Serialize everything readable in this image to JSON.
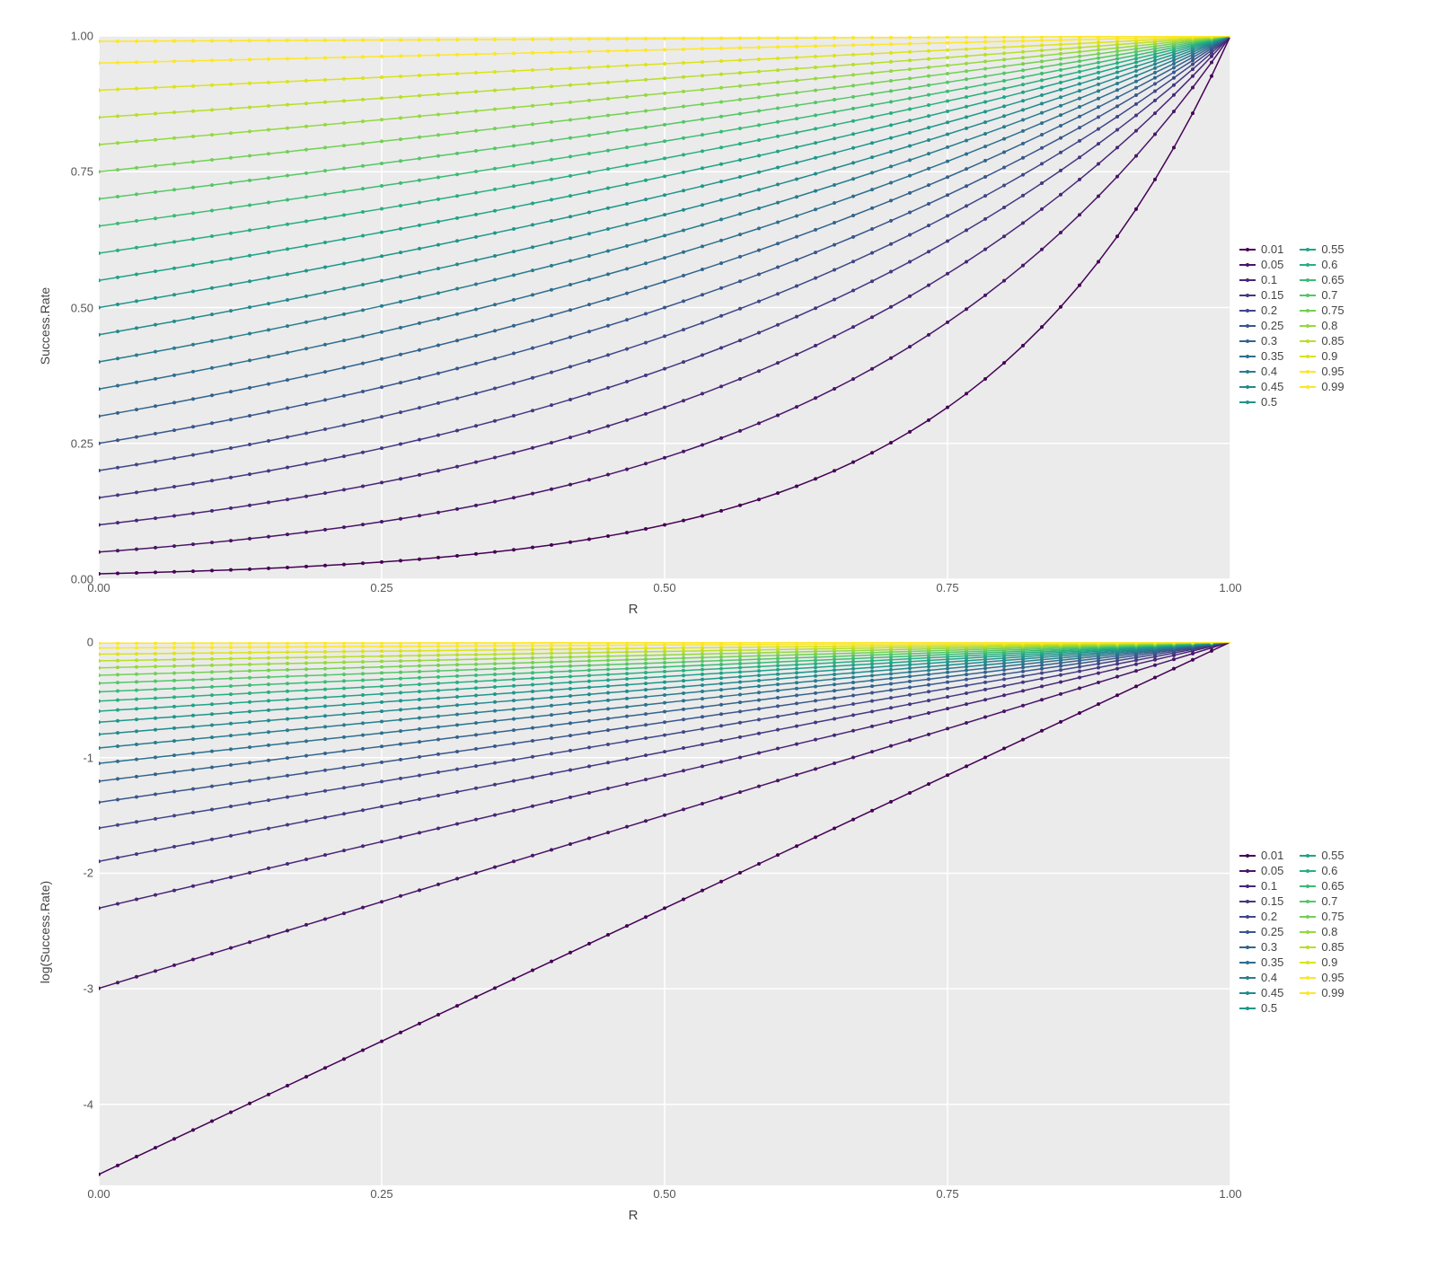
{
  "chart_data": [
    {
      "type": "line",
      "xlabel": "R",
      "ylabel": "Success.Rate",
      "xlim": [
        0,
        1
      ],
      "ylim": [
        0,
        1
      ],
      "xticks": [
        0.0,
        0.25,
        0.5,
        0.75,
        1.0
      ],
      "yticks": [
        0.0,
        0.25,
        0.5,
        0.75,
        1.0
      ],
      "x_n": 60,
      "series_values": [
        0.01,
        0.05,
        0.1,
        0.15,
        0.2,
        0.25,
        0.3,
        0.35,
        0.4,
        0.45,
        0.5,
        0.55,
        0.6,
        0.65,
        0.7,
        0.75,
        0.8,
        0.85,
        0.9,
        0.95,
        0.99
      ],
      "series_colors": [
        "#440154",
        "#481567",
        "#482677",
        "#453781",
        "#404788",
        "#39568c",
        "#33638d",
        "#2d708e",
        "#287d8e",
        "#238a8d",
        "#1f968b",
        "#20a387",
        "#29af7f",
        "#3cbb75",
        "#55c667",
        "#73d055",
        "#95d840",
        "#b8de29",
        "#dce319",
        "#fde725",
        "#fde725"
      ],
      "formula": "pow(sr, 1 - r)"
    },
    {
      "type": "line",
      "xlabel": "R",
      "ylabel": "log(Success.Rate)",
      "xlim": [
        0,
        1
      ],
      "ylim": [
        -4.7,
        0
      ],
      "xticks": [
        0.0,
        0.25,
        0.5,
        0.75,
        1.0
      ],
      "yticks": [
        -4,
        -3,
        -2,
        -1,
        0
      ],
      "x_n": 60,
      "series_values": [
        0.01,
        0.05,
        0.1,
        0.15,
        0.2,
        0.25,
        0.3,
        0.35,
        0.4,
        0.45,
        0.5,
        0.55,
        0.6,
        0.65,
        0.7,
        0.75,
        0.8,
        0.85,
        0.9,
        0.95,
        0.99
      ],
      "series_colors": [
        "#440154",
        "#481567",
        "#482677",
        "#453781",
        "#404788",
        "#39568c",
        "#33638d",
        "#2d708e",
        "#287d8e",
        "#238a8d",
        "#1f968b",
        "#20a387",
        "#29af7f",
        "#3cbb75",
        "#55c667",
        "#73d055",
        "#95d840",
        "#b8de29",
        "#dce319",
        "#fde725",
        "#fde725"
      ],
      "formula": "log(pow(sr, 1 - r))"
    }
  ],
  "legend": {
    "columns": [
      [
        {
          "label": "0.01",
          "color": "#440154"
        },
        {
          "label": "0.05",
          "color": "#481567"
        },
        {
          "label": "0.1",
          "color": "#482677"
        },
        {
          "label": "0.15",
          "color": "#453781"
        },
        {
          "label": "0.2",
          "color": "#404788"
        },
        {
          "label": "0.25",
          "color": "#39568c"
        },
        {
          "label": "0.3",
          "color": "#33638d"
        },
        {
          "label": "0.35",
          "color": "#2d708e"
        },
        {
          "label": "0.4",
          "color": "#287d8e"
        },
        {
          "label": "0.45",
          "color": "#238a8d"
        },
        {
          "label": "0.5",
          "color": "#1f968b"
        }
      ],
      [
        {
          "label": "0.55",
          "color": "#20a387"
        },
        {
          "label": "0.6",
          "color": "#29af7f"
        },
        {
          "label": "0.65",
          "color": "#3cbb75"
        },
        {
          "label": "0.7",
          "color": "#55c667"
        },
        {
          "label": "0.75",
          "color": "#73d055"
        },
        {
          "label": "0.8",
          "color": "#95d840"
        },
        {
          "label": "0.85",
          "color": "#b8de29"
        },
        {
          "label": "0.9",
          "color": "#dce319"
        },
        {
          "label": "0.95",
          "color": "#fde725"
        },
        {
          "label": "0.99",
          "color": "#fde725"
        }
      ]
    ]
  }
}
